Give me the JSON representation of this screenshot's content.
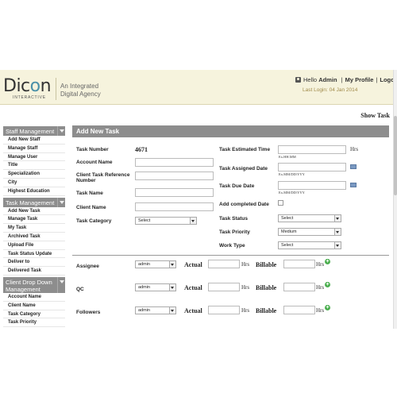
{
  "header": {
    "logo_text_left": "Dic",
    "logo_text_o": "o",
    "logo_text_right": "n",
    "logo_sub": "INTERACTIVE",
    "tagline_line1": "An Integrated",
    "tagline_line2": "Digital Agency",
    "hello": "Hello",
    "username": "Admin",
    "my_profile": "My Profile",
    "logout": "Logout",
    "sep": "|",
    "last_login": "Last Login: 04 Jan 2014"
  },
  "top_link": "Show Task",
  "sidebar": {
    "sections": [
      {
        "title": "Staff Management",
        "items": [
          "Add New Staff",
          "Manage Staff",
          "Manage User",
          "Title",
          "Specialization",
          "City",
          "Highest Education"
        ]
      },
      {
        "title": "Task Management",
        "items": [
          "Add New Task",
          "Manage Task",
          "My Task",
          "Archived Task",
          "Upload File",
          "Task Status Update",
          "Deliver to",
          "Delivered Task"
        ]
      },
      {
        "title": "Client Drop Down Management",
        "items": [
          "Account Name",
          "Client Name",
          "Task Category",
          "Task Priority"
        ]
      }
    ]
  },
  "form": {
    "title": "Add New Task",
    "labels": {
      "task_number": "Task Number",
      "account_name": "Account Name",
      "client_task_ref": "Client Task Reference Number",
      "task_name": "Task Name",
      "client_name": "Client Name",
      "task_category": "Task Category",
      "estimated_time": "Task Estimated Time",
      "assigned_date": "Task Assigned Date",
      "due_date": "Task Due Date",
      "add_completed_date": "Add completed Date",
      "task_status": "Task Status",
      "task_priority": "Task Priority",
      "work_type": "Work Type"
    },
    "task_number_value": "4671",
    "task_category_value": "Select",
    "task_status_value": "Select",
    "task_priority_value": "Medium",
    "work_type_value": "Select",
    "unit_hrs": "Hrs",
    "hint_time": "Ex.HH.MM",
    "hint_date": "Ex.MM/DD/YYY",
    "rows": [
      {
        "label": "Assignee",
        "select": "admin",
        "actual": "Actual",
        "hrs": "Hrs",
        "billable": "Billable",
        "hrs2": "Hrs"
      },
      {
        "label": "QC",
        "select": "admin",
        "actual": "Actual",
        "hrs": "Hrs",
        "billable": "Billable",
        "hrs2": "Hrs"
      },
      {
        "label": "Followers",
        "select": "admin",
        "actual": "Actual",
        "hrs": "Hrs",
        "billable": "Billable",
        "hrs2": "Hrs"
      }
    ],
    "plus_glyph": "+"
  }
}
